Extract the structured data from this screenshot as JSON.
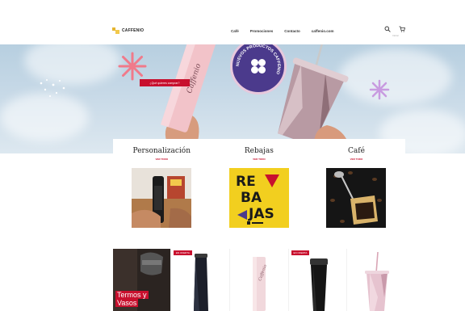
{
  "header": {
    "brand": "CAFFENIO",
    "nav": [
      "Café",
      "Promociones",
      "Contacto",
      "caffenio.com"
    ],
    "account_hint": "Iniciar"
  },
  "hero": {
    "cta_label": "¿Qué quieres comprar?",
    "badge_text": "NUEVOS PRODUCTOS CAFFENIO",
    "tumbler_script": "Caffenio"
  },
  "categories": [
    {
      "title": "Personalización",
      "link": "VER TODO"
    },
    {
      "title": "Rebajas",
      "link": "VER TODO",
      "image_text": [
        "RE",
        "BA",
        "JAS"
      ]
    },
    {
      "title": "Café",
      "link": "VER TODO"
    }
  ],
  "products": {
    "feature_title": [
      "Termos y",
      "Vasos"
    ],
    "tags": [
      "EN OFERTA",
      "EN OFERTA"
    ]
  },
  "colors": {
    "accent": "#c8102e",
    "brand_yellow": "#f2c94c",
    "badge_purple": "#4b3a8c"
  }
}
